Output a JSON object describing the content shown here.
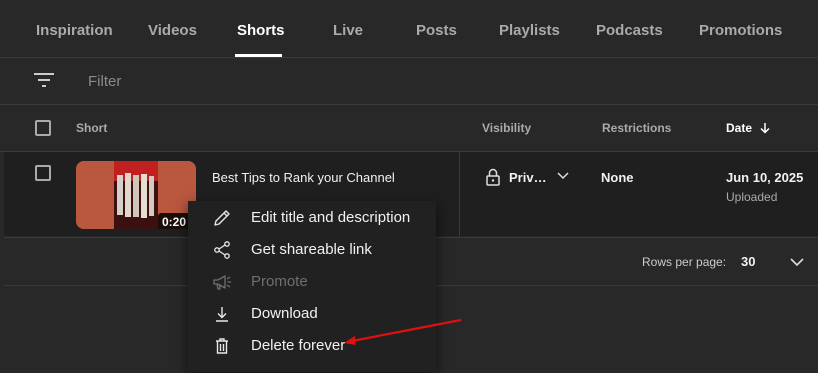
{
  "tabs": [
    {
      "label": "Inspiration"
    },
    {
      "label": "Videos"
    },
    {
      "label": "Shorts",
      "active": true
    },
    {
      "label": "Live"
    },
    {
      "label": "Posts"
    },
    {
      "label": "Playlists"
    },
    {
      "label": "Podcasts"
    },
    {
      "label": "Promotions"
    }
  ],
  "filter": {
    "placeholder": "Filter",
    "icon": "filter-icon"
  },
  "table": {
    "columns": {
      "short": "Short",
      "visibility": "Visibility",
      "restrictions": "Restrictions",
      "date": "Date"
    },
    "sorted_by": "date",
    "sort_direction": "descending",
    "rows": [
      {
        "title": "Best Tips to Rank your Channel",
        "duration": "0:20",
        "visibility": "Priv…",
        "restrictions": "None",
        "date": "Jun 10, 2025",
        "status": "Uploaded"
      }
    ],
    "rows_per_page_label": "Rows per page:",
    "rows_per_page": "30"
  },
  "context_menu": {
    "items": [
      {
        "label": "Edit title and description",
        "icon": "pencil-icon",
        "enabled": true
      },
      {
        "label": "Get shareable link",
        "icon": "share-icon",
        "enabled": true
      },
      {
        "label": "Promote",
        "icon": "megaphone-icon",
        "enabled": false
      },
      {
        "label": "Download",
        "icon": "download-icon",
        "enabled": true
      },
      {
        "label": "Delete forever",
        "icon": "trash-icon",
        "enabled": true
      }
    ]
  },
  "colors": {
    "background": "#282828",
    "row_background": "#1f1f1f",
    "menu_background": "#212121",
    "annotation_arrow": "#e01010"
  }
}
